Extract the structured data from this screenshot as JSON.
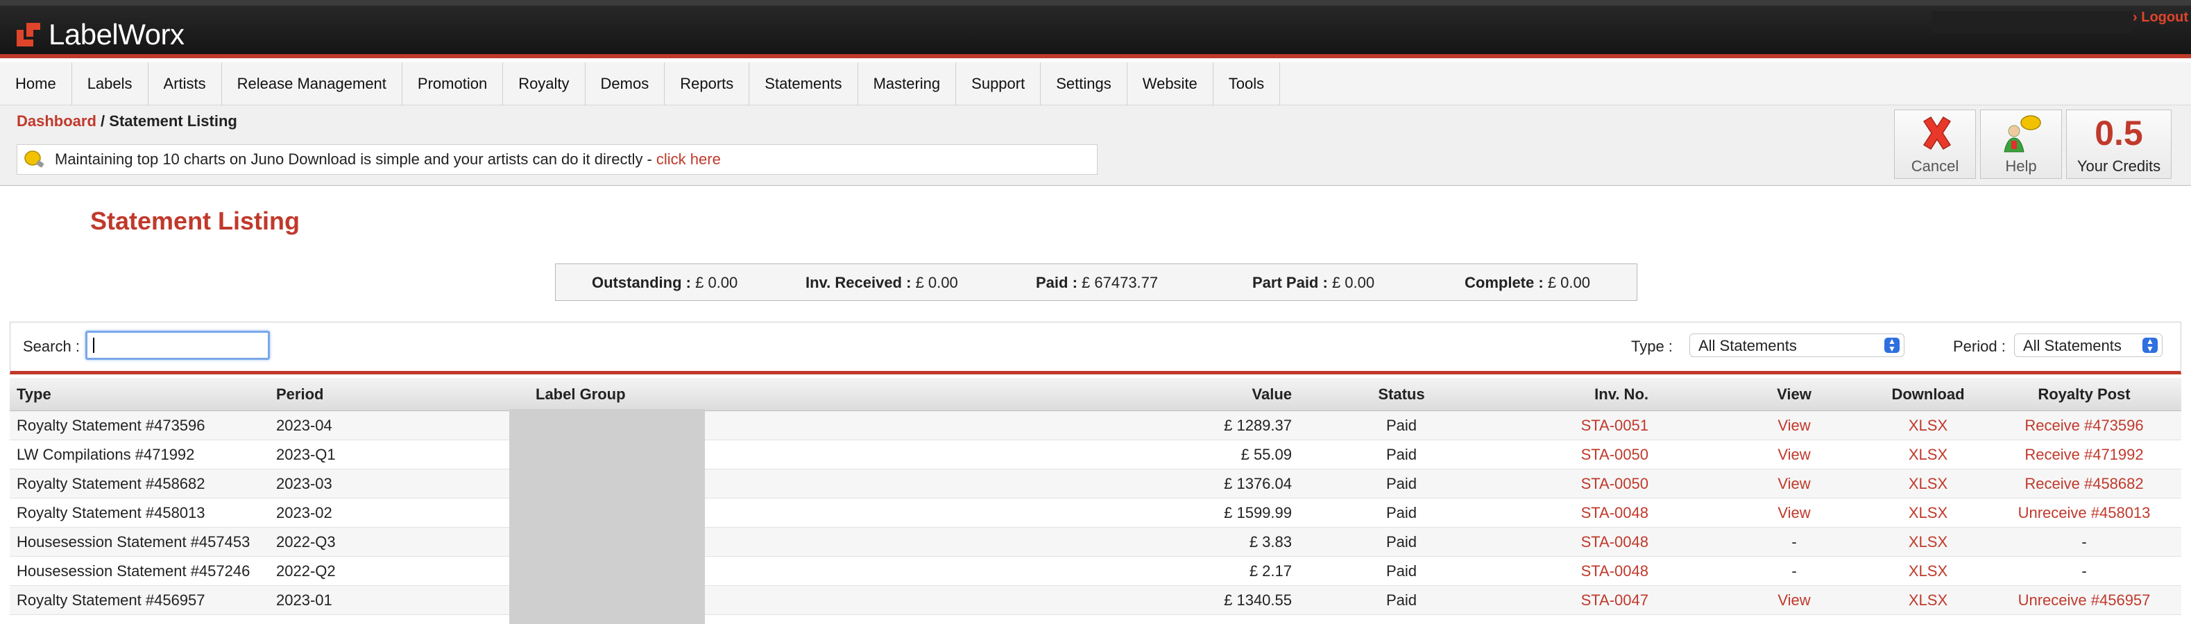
{
  "app": {
    "logo_text": "LabelWorx",
    "logout": "› Logout"
  },
  "nav": [
    "Home",
    "Labels",
    "Artists",
    "Release Management",
    "Promotion",
    "Royalty",
    "Demos",
    "Reports",
    "Statements",
    "Mastering",
    "Support",
    "Settings",
    "Website",
    "Tools"
  ],
  "breadcrumb": {
    "dashboard": "Dashboard",
    "sep": " / ",
    "current": "Statement Listing"
  },
  "notice": {
    "text": "Maintaining top 10 charts on Juno Download is simple and your artists can do it directly -",
    "link": "click here"
  },
  "toolbar": {
    "cancel": "Cancel",
    "help": "Help",
    "credits_value": "0.5",
    "credits_label": "Your Credits"
  },
  "page_title": "Statement Listing",
  "summary": {
    "outstanding_label": "Outstanding :",
    "outstanding": "£ 0.00",
    "inv_received_label": "Inv. Received :",
    "inv_received": "£ 0.00",
    "paid_label": "Paid :",
    "paid": "£ 67473.77",
    "part_paid_label": "Part Paid :",
    "part_paid": "£ 0.00",
    "complete_label": "Complete :",
    "complete": "£ 0.00"
  },
  "filters": {
    "search_label": "Search :",
    "search_value": "",
    "type_label": "Type :",
    "type_value": "All Statements",
    "period_label": "Period :",
    "period_value": "All Statements"
  },
  "table": {
    "headers": {
      "type": "Type",
      "period": "Period",
      "group": "Label Group",
      "value": "Value",
      "status": "Status",
      "inv": "Inv. No.",
      "view": "View",
      "download": "Download",
      "royalty_post": "Royalty Post"
    },
    "rows": [
      {
        "type": "Royalty Statement #473596",
        "period": "2023-04",
        "value": "£ 1289.37",
        "status": "Paid",
        "inv": "STA-0051",
        "view": "View",
        "download": "XLSX",
        "royalty_post": "Receive #473596"
      },
      {
        "type": "LW Compilations #471992",
        "period": "2023-Q1",
        "value": "£ 55.09",
        "status": "Paid",
        "inv": "STA-0050",
        "view": "View",
        "download": "XLSX",
        "royalty_post": "Receive #471992"
      },
      {
        "type": "Royalty Statement #458682",
        "period": "2023-03",
        "value": "£ 1376.04",
        "status": "Paid",
        "inv": "STA-0050",
        "view": "View",
        "download": "XLSX",
        "royalty_post": "Receive #458682"
      },
      {
        "type": "Royalty Statement #458013",
        "period": "2023-02",
        "value": "£ 1599.99",
        "status": "Paid",
        "inv": "STA-0048",
        "view": "View",
        "download": "XLSX",
        "royalty_post": "Unreceive #458013"
      },
      {
        "type": "Housesession Statement #457453",
        "period": "2022-Q3",
        "value": "£ 3.83",
        "status": "Paid",
        "inv": "STA-0048",
        "view": "-",
        "download": "XLSX",
        "royalty_post": "-"
      },
      {
        "type": "Housesession Statement #457246",
        "period": "2022-Q2",
        "value": "£ 2.17",
        "status": "Paid",
        "inv": "STA-0048",
        "view": "-",
        "download": "XLSX",
        "royalty_post": "-"
      },
      {
        "type": "Royalty Statement #456957",
        "period": "2023-01",
        "value": "£ 1340.55",
        "status": "Paid",
        "inv": "STA-0047",
        "view": "View",
        "download": "XLSX",
        "royalty_post": "Unreceive #456957"
      }
    ]
  },
  "colors": {
    "accent": "#c0392b",
    "header_bg": "#1b1b1b"
  }
}
